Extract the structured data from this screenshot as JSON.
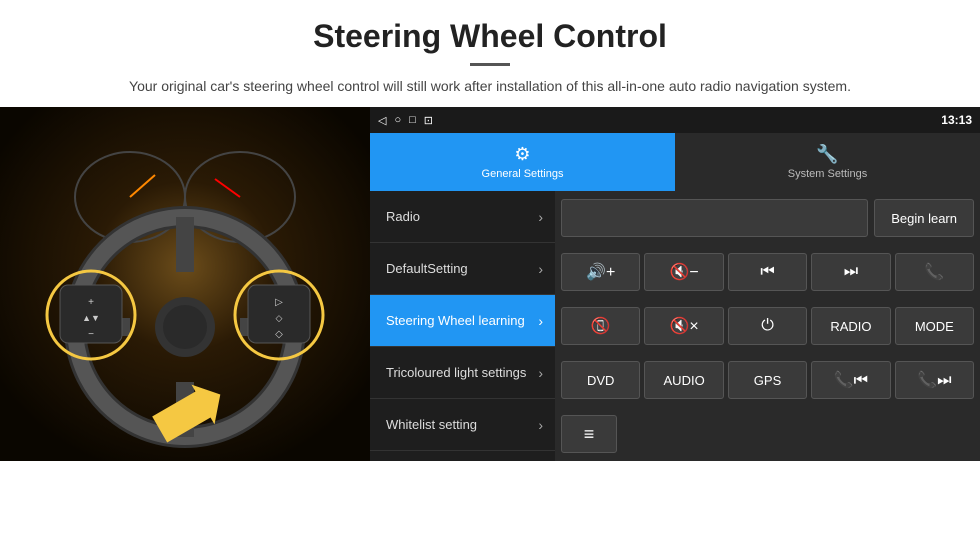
{
  "header": {
    "title": "Steering Wheel Control",
    "description": "Your original car's steering wheel control will still work after installation of this all-in-one auto radio navigation system."
  },
  "status_bar": {
    "icons": [
      "◁",
      "○",
      "□",
      "⊡"
    ],
    "time": "13:13",
    "signal": "▾ ▾"
  },
  "tabs": [
    {
      "id": "general",
      "label": "General Settings",
      "icon": "⚙",
      "active": true
    },
    {
      "id": "system",
      "label": "System Settings",
      "icon": "🔧",
      "active": false
    }
  ],
  "menu_items": [
    {
      "id": "radio",
      "label": "Radio",
      "active": false
    },
    {
      "id": "default",
      "label": "DefaultSetting",
      "active": false
    },
    {
      "id": "steering",
      "label": "Steering Wheel learning",
      "active": true
    },
    {
      "id": "tricoloured",
      "label": "Tricoloured light settings",
      "active": false
    },
    {
      "id": "whitelist",
      "label": "Whitelist setting",
      "active": false
    }
  ],
  "controls": {
    "begin_learn_label": "Begin learn",
    "rows": [
      [
        {
          "id": "vol-up",
          "label": "🔊+",
          "type": "icon"
        },
        {
          "id": "vol-down",
          "label": "🔇−",
          "type": "icon"
        },
        {
          "id": "prev-track",
          "label": "⏮",
          "type": "icon"
        },
        {
          "id": "next-track",
          "label": "⏭",
          "type": "icon"
        },
        {
          "id": "phone",
          "label": "📞",
          "type": "icon"
        }
      ],
      [
        {
          "id": "hang-up",
          "label": "📵",
          "type": "icon"
        },
        {
          "id": "mute",
          "label": "🔇×",
          "type": "icon"
        },
        {
          "id": "power",
          "label": "⏻",
          "type": "icon"
        },
        {
          "id": "radio-btn",
          "label": "RADIO",
          "type": "text"
        },
        {
          "id": "mode",
          "label": "MODE",
          "type": "text"
        }
      ],
      [
        {
          "id": "dvd",
          "label": "DVD",
          "type": "text"
        },
        {
          "id": "audio",
          "label": "AUDIO",
          "type": "text"
        },
        {
          "id": "gps",
          "label": "GPS",
          "type": "text"
        },
        {
          "id": "call-prev",
          "label": "📞⏮",
          "type": "icon"
        },
        {
          "id": "call-next",
          "label": "📞⏭",
          "type": "icon"
        }
      ]
    ],
    "last_row_icon": "≡"
  }
}
